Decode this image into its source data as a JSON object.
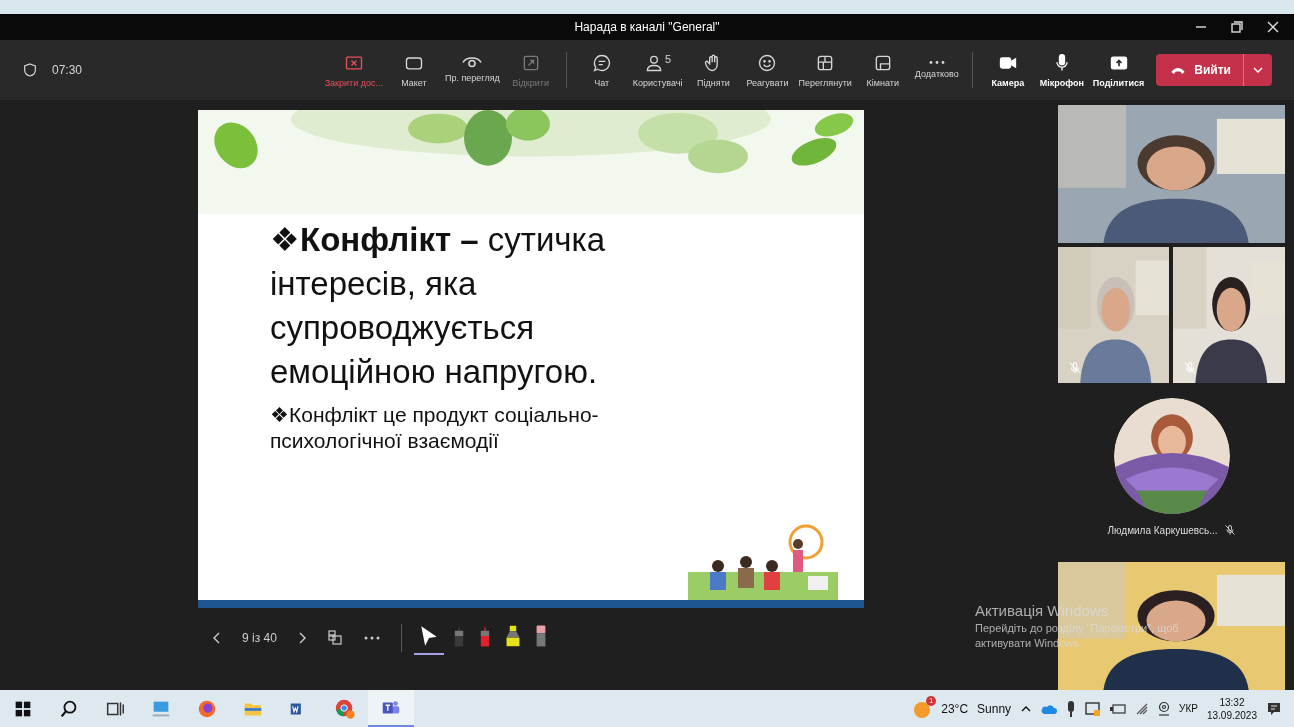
{
  "window": {
    "title": "Нарада в каналі \"General\""
  },
  "meeting_toolbar": {
    "timer": "07:30",
    "buttons": [
      {
        "kind": "stop-share",
        "label": "Закрити дос...",
        "active": true,
        "disabled": false
      },
      {
        "kind": "layout",
        "label": "Макет",
        "active": false,
        "disabled": false
      },
      {
        "kind": "preview",
        "label": "Пр. перегляд",
        "active": false,
        "disabled": false
      },
      {
        "kind": "popout",
        "label": "Відкрити",
        "active": false,
        "disabled": true
      },
      {
        "kind": "chat",
        "label": "Чат",
        "active": false,
        "disabled": false
      },
      {
        "kind": "people",
        "label": "Користувачі",
        "count": "5",
        "active": false,
        "disabled": false
      },
      {
        "kind": "hand",
        "label": "Підняти",
        "active": false,
        "disabled": false
      },
      {
        "kind": "react",
        "label": "Реагувати",
        "active": false,
        "disabled": false
      },
      {
        "kind": "view",
        "label": "Переглянути",
        "active": false,
        "disabled": false
      },
      {
        "kind": "rooms",
        "label": "Кімнати",
        "active": false,
        "disabled": false
      },
      {
        "kind": "more",
        "label": "Додатково",
        "active": false,
        "disabled": false
      },
      {
        "kind": "camera",
        "label": "Камера",
        "active": false,
        "disabled": false
      },
      {
        "kind": "mic",
        "label": "Мікрофон",
        "active": false,
        "disabled": false
      },
      {
        "kind": "share",
        "label": "Поділитися",
        "active": false,
        "disabled": false
      }
    ],
    "leave_button": {
      "label": "Вийти"
    }
  },
  "slide": {
    "bullets": [
      {
        "kind": "main",
        "text": "❖**Конфлікт –** сутичка інтересів, яка супроводжується емоційною напругою."
      },
      {
        "kind": "sub",
        "text": "❖Конфлікт це продукт соціально-психологічної взаємодії"
      }
    ]
  },
  "slide_controls": {
    "page": "9 із 40",
    "tools": [
      {
        "kind": "pointer",
        "selected": true
      },
      {
        "kind": "pen",
        "color": "#3a3a3a",
        "selected": false
      },
      {
        "kind": "pen",
        "color": "#e0202c",
        "selected": false
      },
      {
        "kind": "highlighter",
        "color": "#e6e21a",
        "selected": false
      },
      {
        "kind": "eraser",
        "color": "#e8a0a8",
        "selected": false
      }
    ]
  },
  "participants": [
    {
      "kind": "video",
      "muted": false
    },
    {
      "kind": "video",
      "muted": true
    },
    {
      "kind": "video",
      "muted": true
    },
    {
      "kind": "avatar",
      "name": "Людмила Каркушевсь...",
      "muted": true
    },
    {
      "kind": "video",
      "muted": false
    }
  ],
  "activation_notice": {
    "title": "Активація Windows",
    "text": "Перейдіть до розділу \"Параметри\", щоб активувати Windows."
  },
  "taskbar": {
    "apps": [
      {
        "kind": "start",
        "selected": false
      },
      {
        "kind": "search",
        "selected": false
      },
      {
        "kind": "taskview",
        "selected": false
      },
      {
        "kind": "remote",
        "selected": false
      },
      {
        "kind": "firefox",
        "selected": false
      },
      {
        "kind": "explorer",
        "selected": false
      },
      {
        "kind": "word",
        "selected": false
      },
      {
        "kind": "chrome",
        "selected": false
      },
      {
        "kind": "teams",
        "selected": true
      }
    ],
    "weather": {
      "badge": "1",
      "temperature": "23°C",
      "condition": "Sunny"
    },
    "language": "УКР",
    "time": "13:32",
    "date": "13.09.2023"
  }
}
